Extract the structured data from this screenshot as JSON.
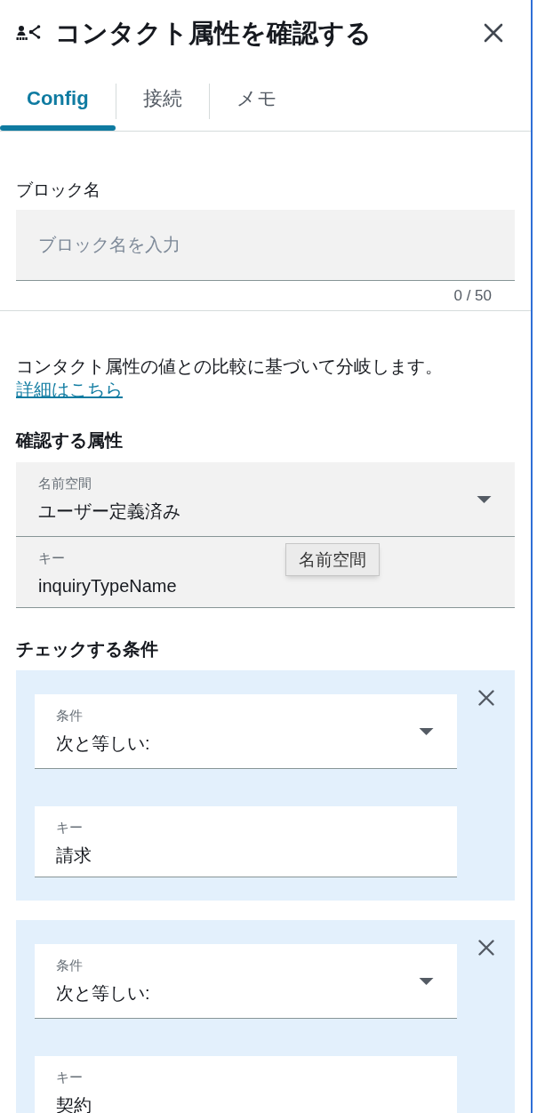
{
  "panel": {
    "title": "コンタクト属性を確認する"
  },
  "tabs": [
    {
      "label": "Config",
      "selected": true
    },
    {
      "label": "接続",
      "selected": false
    },
    {
      "label": "メモ",
      "selected": false
    }
  ],
  "block_name": {
    "label": "ブロック名",
    "placeholder": "ブロック名を入力",
    "counter": "0 / 50"
  },
  "description": {
    "text": "コンタクト属性の値との比較に基づいて分岐します。",
    "link": "詳細はこちら"
  },
  "attribute_section": {
    "heading": "確認する属性",
    "fields": [
      {
        "kind": "select",
        "label": "名前空間",
        "value": "ユーザー定義済み"
      },
      {
        "kind": "text",
        "label": "キー",
        "value": "inquiryTypeName"
      }
    ],
    "tooltip": "名前空間"
  },
  "conditions_section": {
    "heading": "チェックする条件",
    "conditions": [
      {
        "fields": [
          {
            "kind": "select",
            "label": "条件",
            "value": "次と等しい:"
          },
          {
            "kind": "text",
            "label": "キー",
            "value": "請求"
          }
        ]
      },
      {
        "fields": [
          {
            "kind": "select",
            "label": "条件",
            "value": "次と等しい:"
          },
          {
            "kind": "text",
            "label": "キー",
            "value": "契約"
          }
        ]
      }
    ]
  }
}
